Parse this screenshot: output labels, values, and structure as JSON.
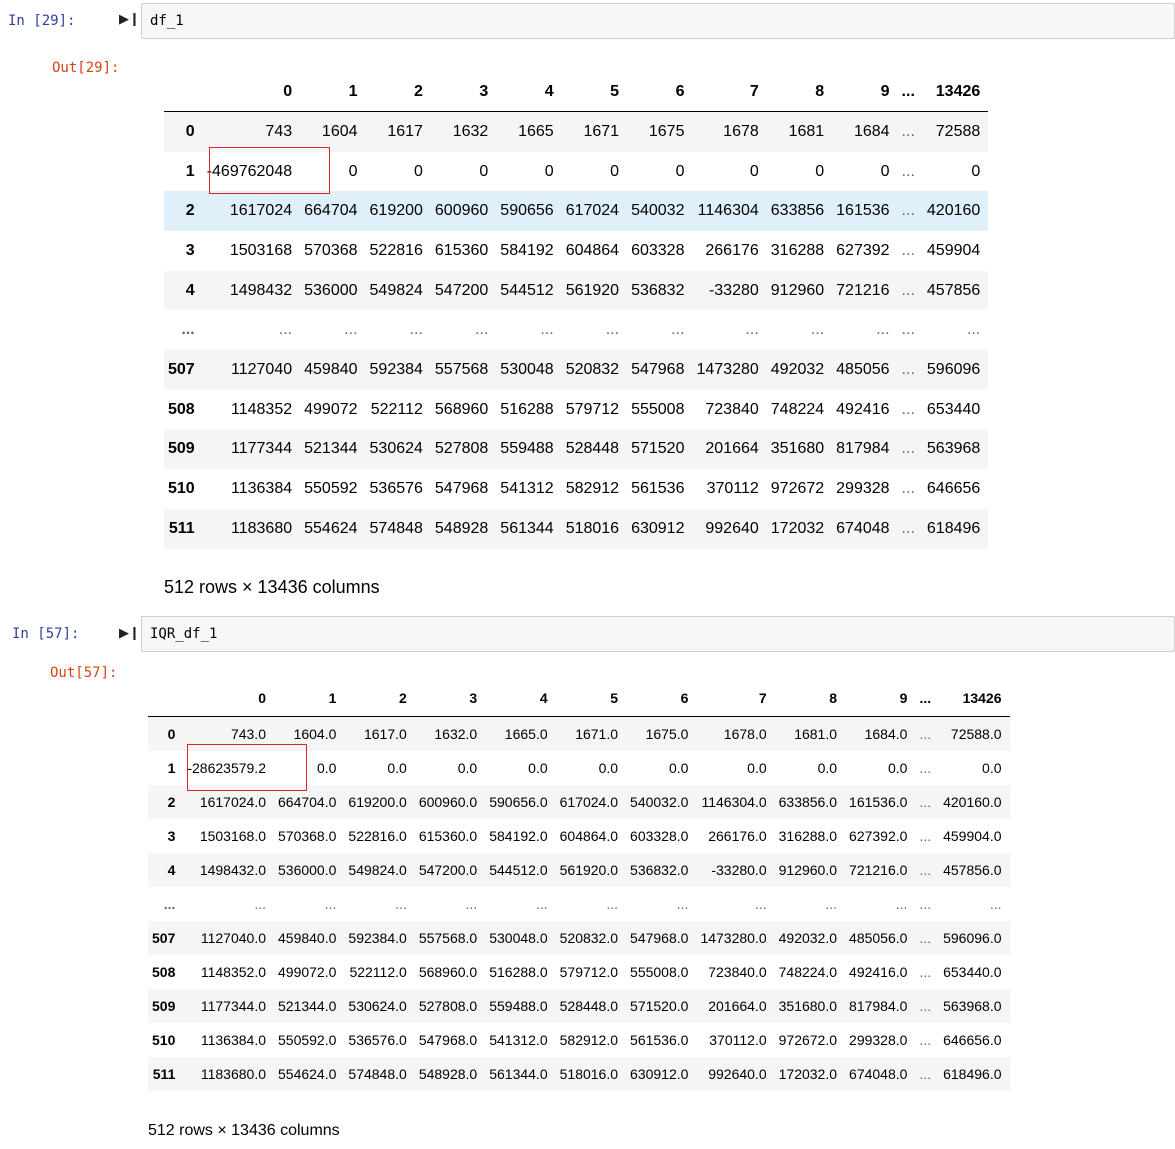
{
  "cells": [
    {
      "in_prompt": "In [29]:",
      "code": "df_1",
      "out_prompt": "Out[29]:",
      "columns": [
        "",
        "0",
        "1",
        "2",
        "3",
        "4",
        "5",
        "6",
        "7",
        "8",
        "9",
        "...",
        "13426"
      ],
      "rows": [
        [
          "0",
          "743",
          "1604",
          "1617",
          "1632",
          "1665",
          "1671",
          "1675",
          "1678",
          "1681",
          "1684",
          "...",
          "72588"
        ],
        [
          "1",
          "-469762048",
          "0",
          "0",
          "0",
          "0",
          "0",
          "0",
          "0",
          "0",
          "0",
          "...",
          "0"
        ],
        [
          "2",
          "1617024",
          "664704",
          "619200",
          "600960",
          "590656",
          "617024",
          "540032",
          "1146304",
          "633856",
          "161536",
          "...",
          "420160"
        ],
        [
          "3",
          "1503168",
          "570368",
          "522816",
          "615360",
          "584192",
          "604864",
          "603328",
          "266176",
          "316288",
          "627392",
          "...",
          "459904"
        ],
        [
          "4",
          "1498432",
          "536000",
          "549824",
          "547200",
          "544512",
          "561920",
          "536832",
          "-33280",
          "912960",
          "721216",
          "...",
          "457856"
        ],
        [
          "...",
          "...",
          "...",
          "...",
          "...",
          "...",
          "...",
          "...",
          "...",
          "...",
          "...",
          "...",
          "..."
        ],
        [
          "507",
          "1127040",
          "459840",
          "592384",
          "557568",
          "530048",
          "520832",
          "547968",
          "1473280",
          "492032",
          "485056",
          "...",
          "596096"
        ],
        [
          "508",
          "1148352",
          "499072",
          "522112",
          "568960",
          "516288",
          "579712",
          "555008",
          "723840",
          "748224",
          "492416",
          "...",
          "653440"
        ],
        [
          "509",
          "1177344",
          "521344",
          "530624",
          "527808",
          "559488",
          "528448",
          "571520",
          "201664",
          "351680",
          "817984",
          "...",
          "563968"
        ],
        [
          "510",
          "1136384",
          "550592",
          "536576",
          "547968",
          "541312",
          "582912",
          "561536",
          "370112",
          "972672",
          "299328",
          "...",
          "646656"
        ],
        [
          "511",
          "1183680",
          "554624",
          "574848",
          "548928",
          "561344",
          "518016",
          "630912",
          "992640",
          "172032",
          "674048",
          "...",
          "618496"
        ]
      ],
      "shape": "512 rows × 13436 columns"
    },
    {
      "in_prompt": "In [57]:",
      "code": "IQR_df_1",
      "out_prompt": "Out[57]:",
      "columns": [
        "",
        "0",
        "1",
        "2",
        "3",
        "4",
        "5",
        "6",
        "7",
        "8",
        "9",
        "...",
        "13426"
      ],
      "rows": [
        [
          "0",
          "743.0",
          "1604.0",
          "1617.0",
          "1632.0",
          "1665.0",
          "1671.0",
          "1675.0",
          "1678.0",
          "1681.0",
          "1684.0",
          "...",
          "72588.0"
        ],
        [
          "1",
          "-28623579.2",
          "0.0",
          "0.0",
          "0.0",
          "0.0",
          "0.0",
          "0.0",
          "0.0",
          "0.0",
          "0.0",
          "...",
          "0.0"
        ],
        [
          "2",
          "1617024.0",
          "664704.0",
          "619200.0",
          "600960.0",
          "590656.0",
          "617024.0",
          "540032.0",
          "1146304.0",
          "633856.0",
          "161536.0",
          "...",
          "420160.0"
        ],
        [
          "3",
          "1503168.0",
          "570368.0",
          "522816.0",
          "615360.0",
          "584192.0",
          "604864.0",
          "603328.0",
          "266176.0",
          "316288.0",
          "627392.0",
          "...",
          "459904.0"
        ],
        [
          "4",
          "1498432.0",
          "536000.0",
          "549824.0",
          "547200.0",
          "544512.0",
          "561920.0",
          "536832.0",
          "-33280.0",
          "912960.0",
          "721216.0",
          "...",
          "457856.0"
        ],
        [
          "...",
          "...",
          "...",
          "...",
          "...",
          "...",
          "...",
          "...",
          "...",
          "...",
          "...",
          "...",
          "..."
        ],
        [
          "507",
          "1127040.0",
          "459840.0",
          "592384.0",
          "557568.0",
          "530048.0",
          "520832.0",
          "547968.0",
          "1473280.0",
          "492032.0",
          "485056.0",
          "...",
          "596096.0"
        ],
        [
          "508",
          "1148352.0",
          "499072.0",
          "522112.0",
          "568960.0",
          "516288.0",
          "579712.0",
          "555008.0",
          "723840.0",
          "748224.0",
          "492416.0",
          "...",
          "653440.0"
        ],
        [
          "509",
          "1177344.0",
          "521344.0",
          "530624.0",
          "527808.0",
          "559488.0",
          "528448.0",
          "571520.0",
          "201664.0",
          "351680.0",
          "817984.0",
          "...",
          "563968.0"
        ],
        [
          "510",
          "1136384.0",
          "550592.0",
          "536576.0",
          "547968.0",
          "541312.0",
          "582912.0",
          "561536.0",
          "370112.0",
          "972672.0",
          "299328.0",
          "...",
          "646656.0"
        ],
        [
          "511",
          "1183680.0",
          "554624.0",
          "574848.0",
          "548928.0",
          "561344.0",
          "518016.0",
          "630912.0",
          "992640.0",
          "172032.0",
          "674048.0",
          "...",
          "618496.0"
        ]
      ],
      "shape": "512 rows × 13436 columns"
    }
  ],
  "icons": {
    "run": "step-run-icon"
  },
  "colors": {
    "in_prompt": "#303f9f",
    "out_prompt": "#d84315",
    "highlight_box": "#e0242a",
    "selected_row": "#dff0fb"
  }
}
